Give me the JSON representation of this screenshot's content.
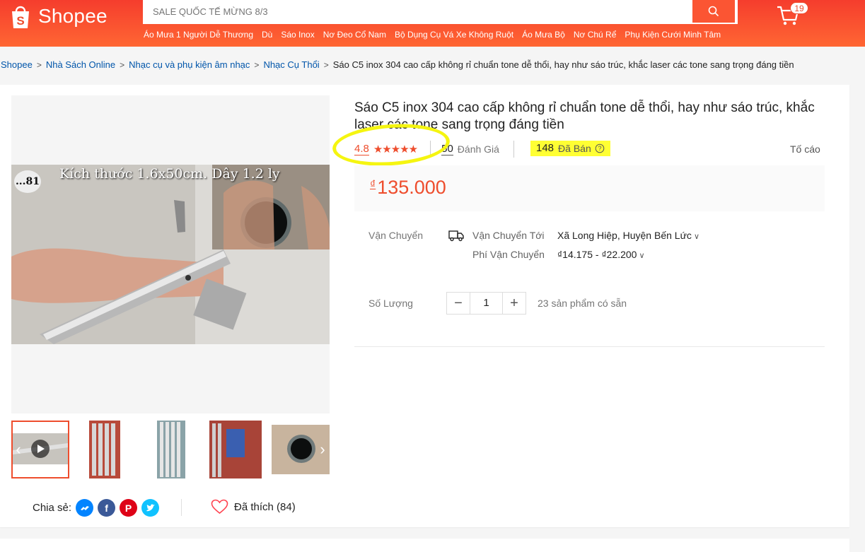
{
  "header": {
    "logo_text": "Shopee",
    "search_placeholder": "SALE QUỐC TẾ MỪNG 8/3",
    "cart_count": "19",
    "hotwords": [
      "Áo Mưa 1 Người Dễ Thương",
      "Dù",
      "Sáo Inox",
      "Nơ Đeo Cổ Nam",
      "Bộ Dụng Cụ Vá Xe Không Ruột",
      "Áo Mưa Bộ",
      "Nơ Chú Rể",
      "Phụ Kiện Cưới Minh Tâm"
    ]
  },
  "breadcrumb": {
    "items": [
      "Shopee",
      "Nhà Sách Online",
      "Nhạc cụ và phụ kiện âm nhạc",
      "Nhạc Cụ Thổi"
    ],
    "current": "Sáo C5 inox 304 cao cấp không rỉ chuẩn tone dễ thổi, hay như sáo trúc, khắc laser các tone sang trọng đáng tiền"
  },
  "product": {
    "title": "Sáo C5 inox 304 cao cấp không rỉ chuẩn tone dễ thổi, hay như sáo trúc, khắc laser các tone sang trọng đáng tiền",
    "rating": "4.8",
    "stars": "★★★★★",
    "review_count": "50",
    "review_label": "Đánh Giá",
    "sold_count": "148",
    "sold_label": "Đã Bán",
    "report_label": "Tố cáo",
    "currency": "₫",
    "price": "135.000",
    "image_caption": "Kích thước 1.6x50cm. Dây 1.2 ly",
    "image_badge": "...81"
  },
  "shipping": {
    "label": "Vận Chuyển",
    "to_label": "Vận Chuyển Tới",
    "to_value": "Xã Long Hiệp, Huyện Bến Lức",
    "fee_label": "Phí Vận Chuyển",
    "fee_value": "₫14.175 - ₫22.200"
  },
  "quantity": {
    "label": "Số Lượng",
    "value": "1",
    "minus": "−",
    "plus": "+",
    "stock": "23 sản phẩm có sẵn"
  },
  "share": {
    "label": "Chia sẻ:",
    "like_label": "Đã thích (84)"
  },
  "colors": {
    "brand": "#ee4d2d",
    "highlight": "#ffff33"
  }
}
